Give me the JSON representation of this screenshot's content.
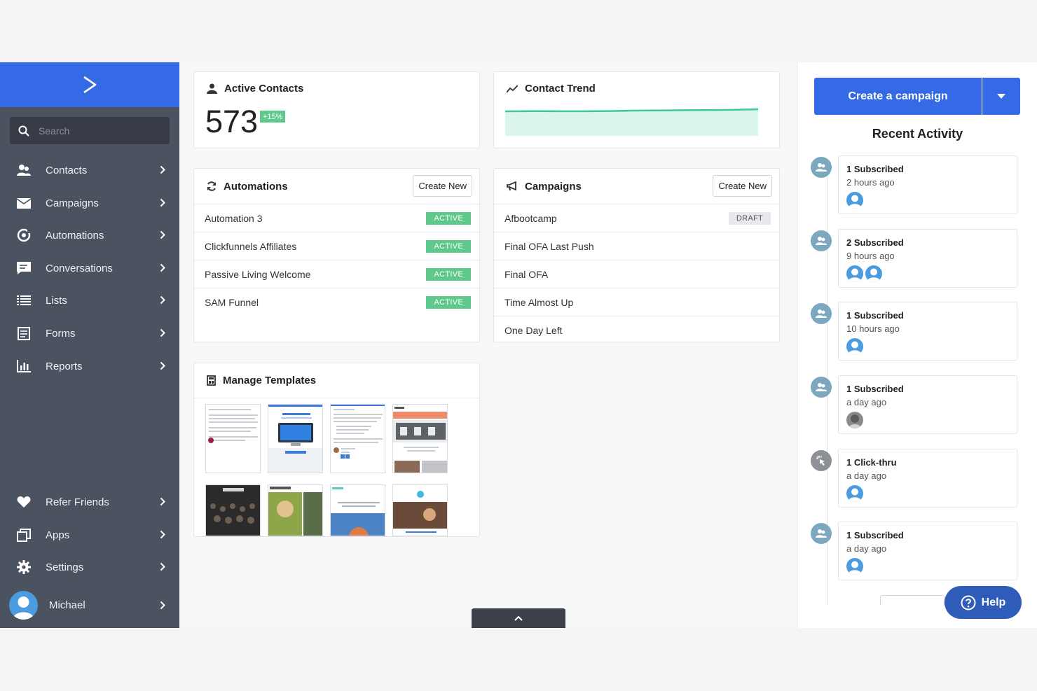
{
  "search": {
    "placeholder": "Search"
  },
  "sidebar": {
    "items": [
      {
        "label": "Contacts"
      },
      {
        "label": "Campaigns"
      },
      {
        "label": "Automations"
      },
      {
        "label": "Conversations"
      },
      {
        "label": "Lists"
      },
      {
        "label": "Forms"
      },
      {
        "label": "Reports"
      }
    ],
    "bottom_items": [
      {
        "label": "Refer Friends"
      },
      {
        "label": "Apps"
      },
      {
        "label": "Settings"
      }
    ],
    "user": {
      "name": "Michael"
    }
  },
  "active_contacts": {
    "title": "Active Contacts",
    "count": "573",
    "change": "+15%"
  },
  "contact_trend": {
    "title": "Contact Trend",
    "line_color": "#3cc99a",
    "fill_color": "#d9f5ec"
  },
  "automations": {
    "title": "Automations",
    "create_label": "Create New",
    "rows": [
      {
        "name": "Automation 3",
        "status": "ACTIVE"
      },
      {
        "name": "Clickfunnels Affiliates",
        "status": "ACTIVE"
      },
      {
        "name": "Passive Living Welcome",
        "status": "ACTIVE"
      },
      {
        "name": "SAM Funnel",
        "status": "ACTIVE"
      }
    ]
  },
  "campaigns": {
    "title": "Campaigns",
    "create_label": "Create New",
    "rows": [
      {
        "name": "Afbootcamp",
        "status": "DRAFT"
      },
      {
        "name": "Final OFA Last Push",
        "status": ""
      },
      {
        "name": "Final OFA",
        "status": ""
      },
      {
        "name": "Time Almost Up",
        "status": ""
      },
      {
        "name": "One Day Left",
        "status": ""
      }
    ]
  },
  "templates": {
    "title": "Manage Templates"
  },
  "right": {
    "create_label": "Create a campaign",
    "recent_title": "Recent Activity",
    "activity": [
      {
        "title": "1 Subscribed",
        "time": "2 hours ago"
      },
      {
        "title": "2 Subscribed",
        "time": "9 hours ago"
      },
      {
        "title": "1 Subscribed",
        "time": "10 hours ago"
      },
      {
        "title": "1 Subscribed",
        "time": "a day ago"
      },
      {
        "title": "1 Click-thru",
        "time": "a day ago"
      },
      {
        "title": "1 Subscribed",
        "time": "a day ago"
      }
    ]
  },
  "help": {
    "label": "Help"
  },
  "colors": {
    "brand": "#356ae6",
    "sidebar": "#4b5260",
    "active": "#5ec98b"
  }
}
